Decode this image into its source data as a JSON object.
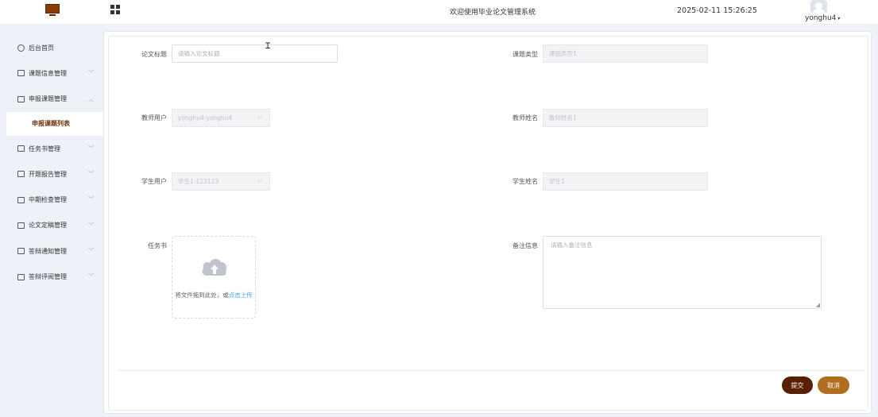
{
  "header": {
    "title": "欢迎使用毕业论文管理系统",
    "datetime": "2025-02-11 15:26:25",
    "username": "yonghu4",
    "logo_icon": "monitor-icon",
    "apps_icon": "grid-icon"
  },
  "sidebar": {
    "items": [
      {
        "label": "后台首页",
        "icon": "clock-icon"
      },
      {
        "label": "课题信息管理",
        "icon": "menu-icon"
      },
      {
        "label": "申报课题管理",
        "icon": "menu-icon"
      },
      {
        "label": "任务书管理",
        "icon": "menu-icon"
      },
      {
        "label": "开题报告管理",
        "icon": "menu-icon"
      },
      {
        "label": "中期检查管理",
        "icon": "menu-icon"
      },
      {
        "label": "论文定稿管理",
        "icon": "menu-icon"
      },
      {
        "label": "答辩通知管理",
        "icon": "menu-icon"
      },
      {
        "label": "答辩评阅管理",
        "icon": "menu-icon"
      }
    ],
    "active_sub": "申报课题列表"
  },
  "form": {
    "paper_title": {
      "label": "论文标题",
      "placeholder": "请输入论文标题"
    },
    "topic_type": {
      "label": "课题类型",
      "value": "课题类型1"
    },
    "teacher_user": {
      "label": "教师用户",
      "value": "yonghu4-yonghu4"
    },
    "teacher_name": {
      "label": "教师姓名",
      "value": "教师姓名1"
    },
    "student_user": {
      "label": "学生用户",
      "value": "学生1-123123"
    },
    "student_name": {
      "label": "学生姓名",
      "value": "学生1"
    },
    "task_book": {
      "label": "任务书",
      "hint": "将文件拖到此处，或",
      "hint_link": "点击上传"
    },
    "remark": {
      "label": "备注信息",
      "placeholder": "请输入备注信息"
    }
  },
  "actions": {
    "submit": "提交",
    "cancel": "取消"
  },
  "colors": {
    "submit": "#5a2006",
    "cancel": "#b06c1f",
    "active_menu": "#6b2f0a"
  }
}
